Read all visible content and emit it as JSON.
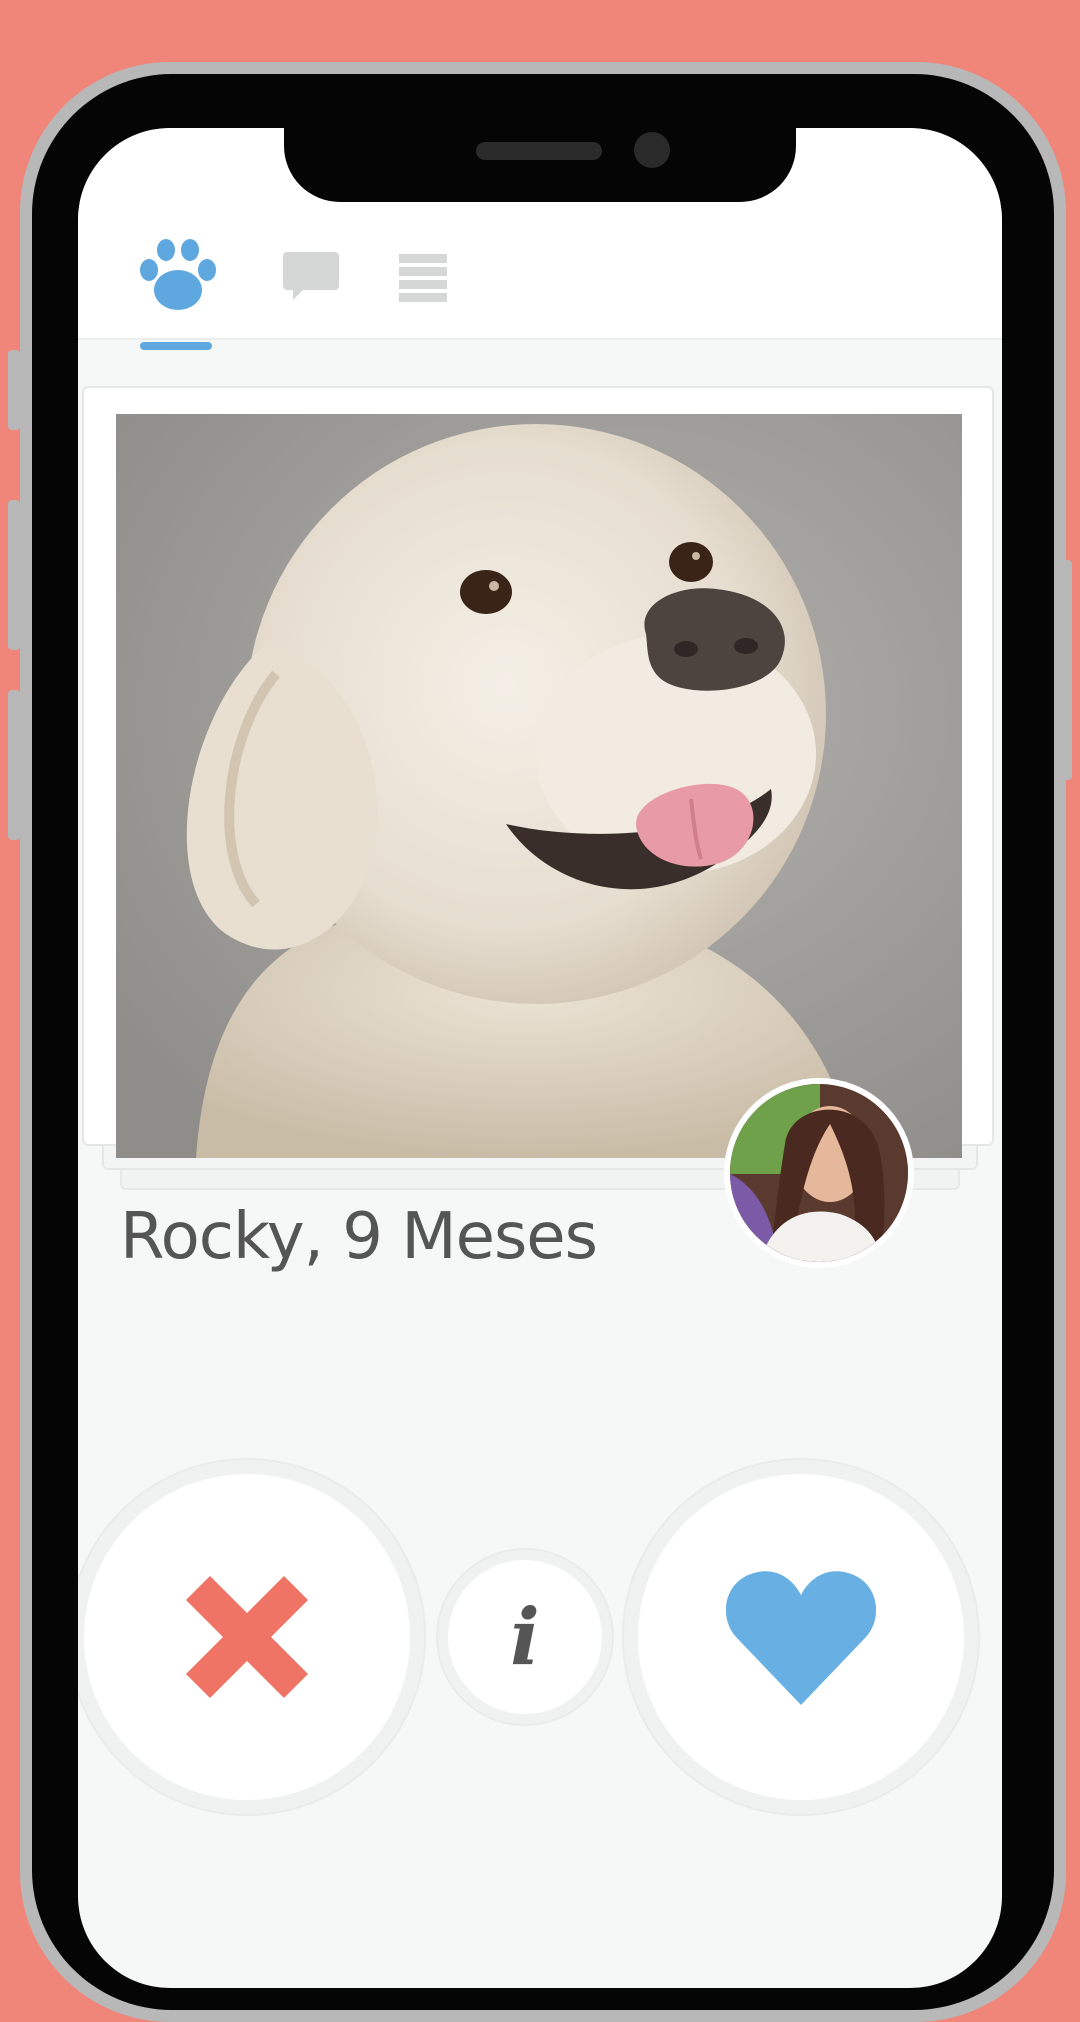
{
  "app": {
    "tabs": [
      {
        "name": "paw",
        "icon": "paw-icon",
        "active": true
      },
      {
        "name": "chat",
        "icon": "chat-bubble-icon",
        "active": false
      },
      {
        "name": "list",
        "icon": "list-icon",
        "active": false
      }
    ]
  },
  "card": {
    "pet_name_age": "Rocky, 9 Meses",
    "photo_subject": "golden-retriever-photo",
    "owner_avatar": "owner-avatar-photo"
  },
  "actions": {
    "reject_icon": "close-x-icon",
    "info_label": "i",
    "like_icon": "heart-icon"
  },
  "colors": {
    "background": "#f0857a",
    "accent_blue": "#5fa8df",
    "reject_red": "#ef7466",
    "tab_inactive": "#d5d7d7"
  }
}
